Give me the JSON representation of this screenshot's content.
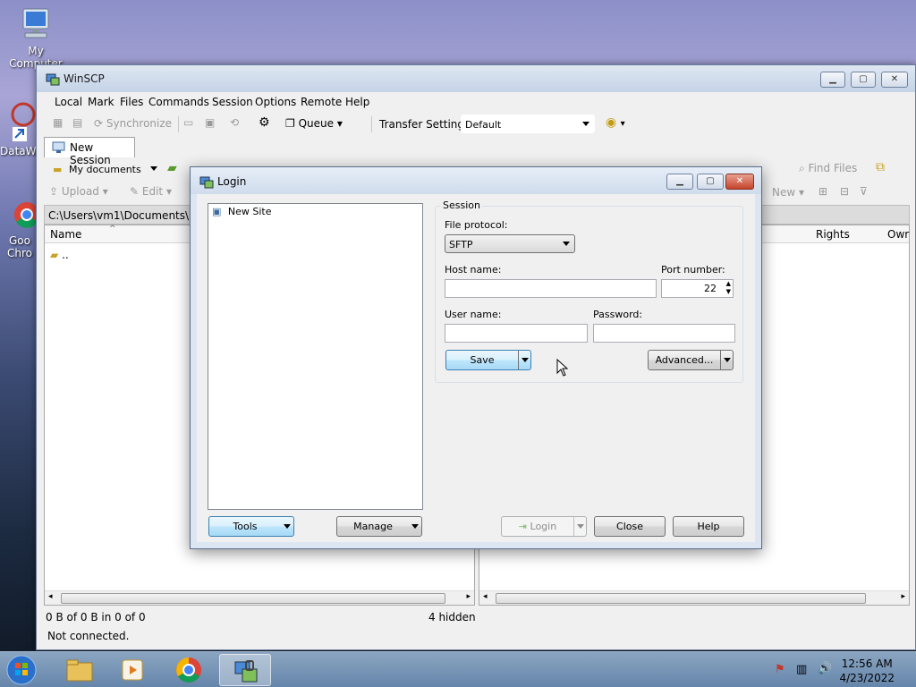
{
  "desktop": {
    "icons": [
      {
        "label": "My Computer"
      },
      {
        "label": "DataWa"
      },
      {
        "label": "Goo"
      },
      {
        "label": "Chro"
      }
    ]
  },
  "winscp": {
    "title": "WinSCP",
    "menu": [
      "Local",
      "Mark",
      "Files",
      "Commands",
      "Session",
      "Options",
      "Remote",
      "Help"
    ],
    "toolbar": {
      "synchronize": "Synchronize",
      "queue": "Queue",
      "transfer_settings_label": "Transfer Settings",
      "transfer_settings_value": "Default"
    },
    "session_tab": "New Session",
    "local": {
      "location": "My documents",
      "upload": "Upload",
      "edit": "Edit",
      "path": "C:\\Users\\vm1\\Documents\\",
      "col_name": "Name",
      "rows": [
        ".."
      ],
      "status": "0 B of 0 B in 0 of 0",
      "hidden": "4 hidden"
    },
    "remote": {
      "find_files": "Find Files",
      "new": "New",
      "col_rights": "Rights",
      "col_owner": "Owr"
    },
    "connection_status": "Not connected."
  },
  "login": {
    "title": "Login",
    "sites": [
      "New Site"
    ],
    "session_group": "Session",
    "file_protocol_label": "File protocol:",
    "file_protocol_value": "SFTP",
    "host_name_label": "Host name:",
    "host_name_value": "",
    "port_number_label": "Port number:",
    "port_number_value": "22",
    "user_name_label": "User name:",
    "user_name_value": "",
    "password_label": "Password:",
    "password_value": "",
    "save": "Save",
    "advanced": "Advanced...",
    "tools": "Tools",
    "manage": "Manage",
    "login": "Login",
    "close": "Close",
    "help": "Help"
  },
  "taskbar": {
    "time": "12:56 AM",
    "date": "4/23/2022"
  }
}
